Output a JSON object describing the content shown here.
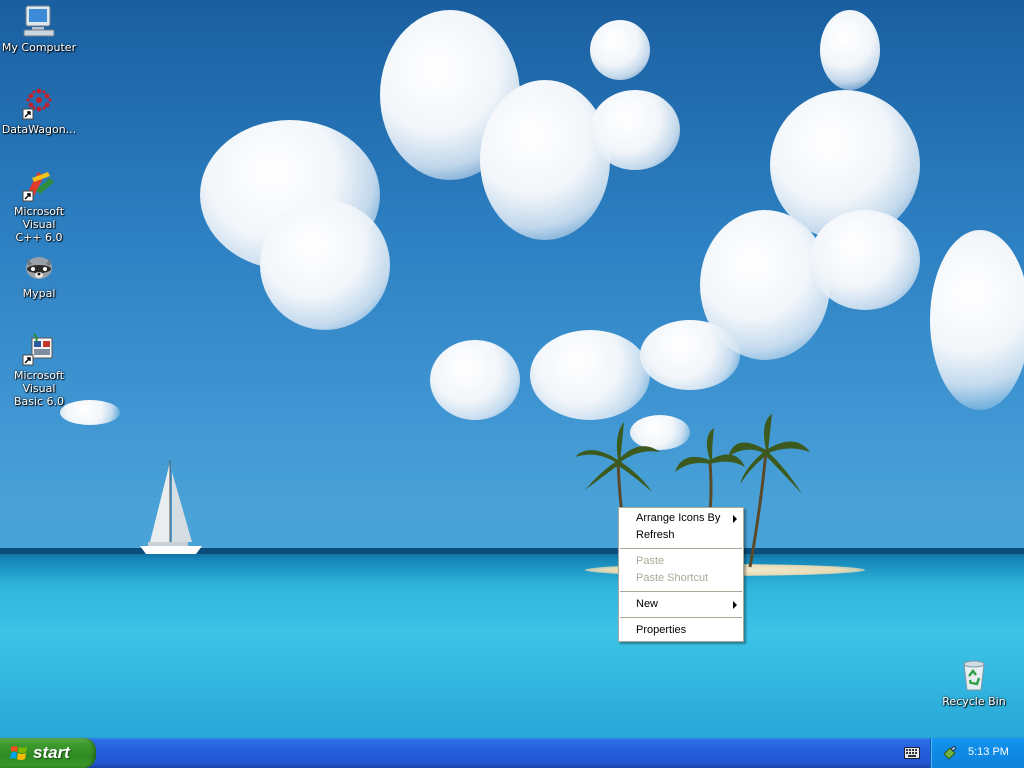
{
  "desktop": {
    "icons": [
      {
        "label": "My Computer",
        "icon": "my-computer-icon"
      },
      {
        "label": "DataWagon...",
        "icon": "datawagon-shortcut-icon"
      },
      {
        "label": "Microsoft Visual\nC++ 6.0",
        "icon": "visual-cpp-shortcut-icon"
      },
      {
        "label": "Mypal",
        "icon": "mypal-raccoon-icon"
      },
      {
        "label": "Microsoft Visual\nBasic 6.0",
        "icon": "visual-basic-shortcut-icon"
      },
      {
        "label": "Recycle Bin",
        "icon": "recycle-bin-icon"
      }
    ]
  },
  "context_menu": {
    "arrange_icons_by": "Arrange Icons By",
    "refresh": "Refresh",
    "paste": "Paste",
    "paste_shortcut": "Paste Shortcut",
    "new": "New",
    "properties": "Properties"
  },
  "taskbar": {
    "start_label": "start",
    "clock": "5:13 PM",
    "colors": {
      "taskbar": "#245edb",
      "start": "#3e9c2f",
      "tray": "#0f8be6"
    }
  }
}
